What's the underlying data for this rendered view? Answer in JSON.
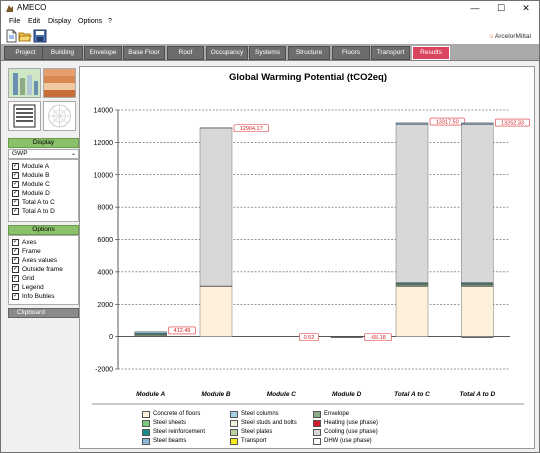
{
  "window": {
    "title": "AMECO",
    "minimize": "—",
    "maximize": "☐",
    "close": "✕"
  },
  "menu": [
    "File",
    "Edit",
    "Display",
    "Options",
    "?"
  ],
  "toolbar": {
    "icons": [
      "new-file-icon",
      "open-folder-icon",
      "save-icon"
    ]
  },
  "brand": {
    "prefix": "",
    "name": "ArcelorMittal"
  },
  "tabs": [
    "Project",
    "Building",
    "Envelope",
    "Base Floor",
    "Roof",
    "Occupancy",
    "Systems",
    "Structure",
    "Floors",
    "Transport",
    "Results"
  ],
  "active_tab": "Results",
  "left": {
    "display_header": "Display",
    "indicator_value": "GWP",
    "modules": [
      {
        "label": "Module A",
        "checked": true
      },
      {
        "label": "Module B",
        "checked": true
      },
      {
        "label": "Module C",
        "checked": true
      },
      {
        "label": "Module D",
        "checked": true
      },
      {
        "label": "Total A to C",
        "checked": true
      },
      {
        "label": "Total A to D",
        "checked": true
      }
    ],
    "options_header": "Options",
    "options": [
      {
        "label": "Axes",
        "checked": true
      },
      {
        "label": "Frame",
        "checked": true
      },
      {
        "label": "Axes values",
        "checked": true
      },
      {
        "label": "Outside frame",
        "checked": true
      },
      {
        "label": "Grid",
        "checked": true
      },
      {
        "label": "Legend",
        "checked": true
      },
      {
        "label": "Info Bubles",
        "checked": true
      }
    ],
    "clipboard_header": "Clipboard",
    "check_glyph": "✓"
  },
  "chart_data": {
    "type": "bar",
    "stacked": true,
    "title": "Global Warming Potential (tCO2eq)",
    "categories": [
      "Module A",
      "Module B",
      "Module C",
      "Module D",
      "Total A to C",
      "Total A to D"
    ],
    "ylim": [
      -2000,
      14000
    ],
    "yticks": [
      -2000,
      0,
      2000,
      4000,
      6000,
      8000,
      10000,
      12000,
      14000
    ],
    "grid": true,
    "legend_position": "bottom",
    "series": [
      {
        "name": "Concrete of floors",
        "color": "#fdf1dc",
        "values": [
          0,
          3100,
          0,
          0,
          3100,
          3100
        ]
      },
      {
        "name": "Steel columns",
        "color": "#a7cfe3",
        "values": [
          20,
          0,
          0,
          0,
          20,
          20
        ]
      },
      {
        "name": "Envelope",
        "color": "#8cab84",
        "values": [
          70,
          0,
          0,
          0,
          70,
          70
        ]
      },
      {
        "name": "Steel sheets",
        "color": "#7bc87a",
        "values": [
          40,
          0,
          0,
          0,
          40,
          40
        ]
      },
      {
        "name": "Steel studs and bolts",
        "color": "#eef3dc",
        "values": [
          10,
          0,
          0,
          0,
          10,
          10
        ]
      },
      {
        "name": "Heating (use phase)",
        "color": "#d11c2e",
        "values": [
          0,
          30,
          0,
          0,
          30,
          30
        ]
      },
      {
        "name": "Steel reinforcement",
        "color": "#178c87",
        "values": [
          60,
          0,
          0,
          0,
          60,
          60
        ]
      },
      {
        "name": "Steel plates",
        "color": "#b9d19d",
        "values": [
          10,
          0,
          0,
          0,
          10,
          10
        ]
      },
      {
        "name": "Cooling (use phase)",
        "color": "#d8d8d8",
        "values": [
          0,
          9750,
          0,
          0,
          9750,
          9750
        ]
      },
      {
        "name": "Steel beams",
        "color": "#8fb6d3",
        "values": [
          90,
          0,
          0,
          0,
          90,
          90
        ]
      },
      {
        "name": "Transport",
        "color": "#f5ec1a",
        "values": [
          5,
          0,
          0,
          0,
          5,
          5
        ]
      },
      {
        "name": "DHW (use phase)",
        "color": "#fbfbfb",
        "values": [
          0,
          24,
          0,
          0,
          24,
          24
        ]
      }
    ],
    "negatives": [
      0,
      0,
      0,
      -65,
      0,
      -65
    ],
    "data_labels": [
      "412.49",
      "12904.17",
      "0.52",
      "-65.18",
      "13317.50",
      "13252.33"
    ],
    "totals": [
      412.49,
      12904.17,
      0.52,
      -65.18,
      13317.5,
      13252.33
    ]
  }
}
